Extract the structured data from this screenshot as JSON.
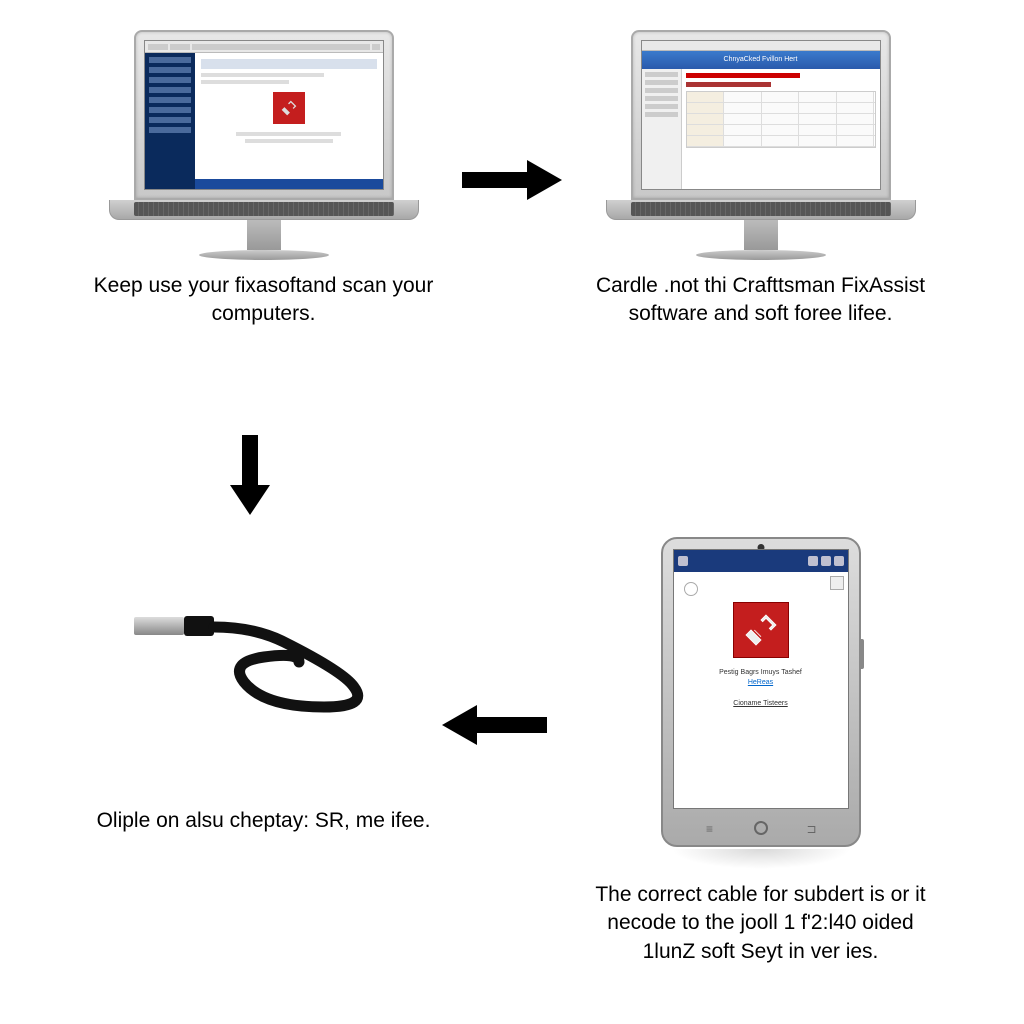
{
  "captions": {
    "topLeft": "Keep use your fixasoftand scan your computers.",
    "topRight": "Cardle .not thi Crafttsman FixAssist software and soft foree lifee.",
    "bottomLeft": "Oliple on alsu cheptay: SR, me ifee.",
    "bottomRight": "The correct cable for subdert is or it necode to the jooll 1 f'2:l40 oided 1lunZ soft Seyt in ver ies."
  },
  "screenB": {
    "header": "ChnyaCked Fvillon Hert"
  },
  "device": {
    "title1": "Pestig Bagrs Imuys Tashef",
    "link": "HeReas",
    "sub": "Cioname Tisteers"
  },
  "buttons": {
    "menu": "≡",
    "back": "⊐"
  }
}
